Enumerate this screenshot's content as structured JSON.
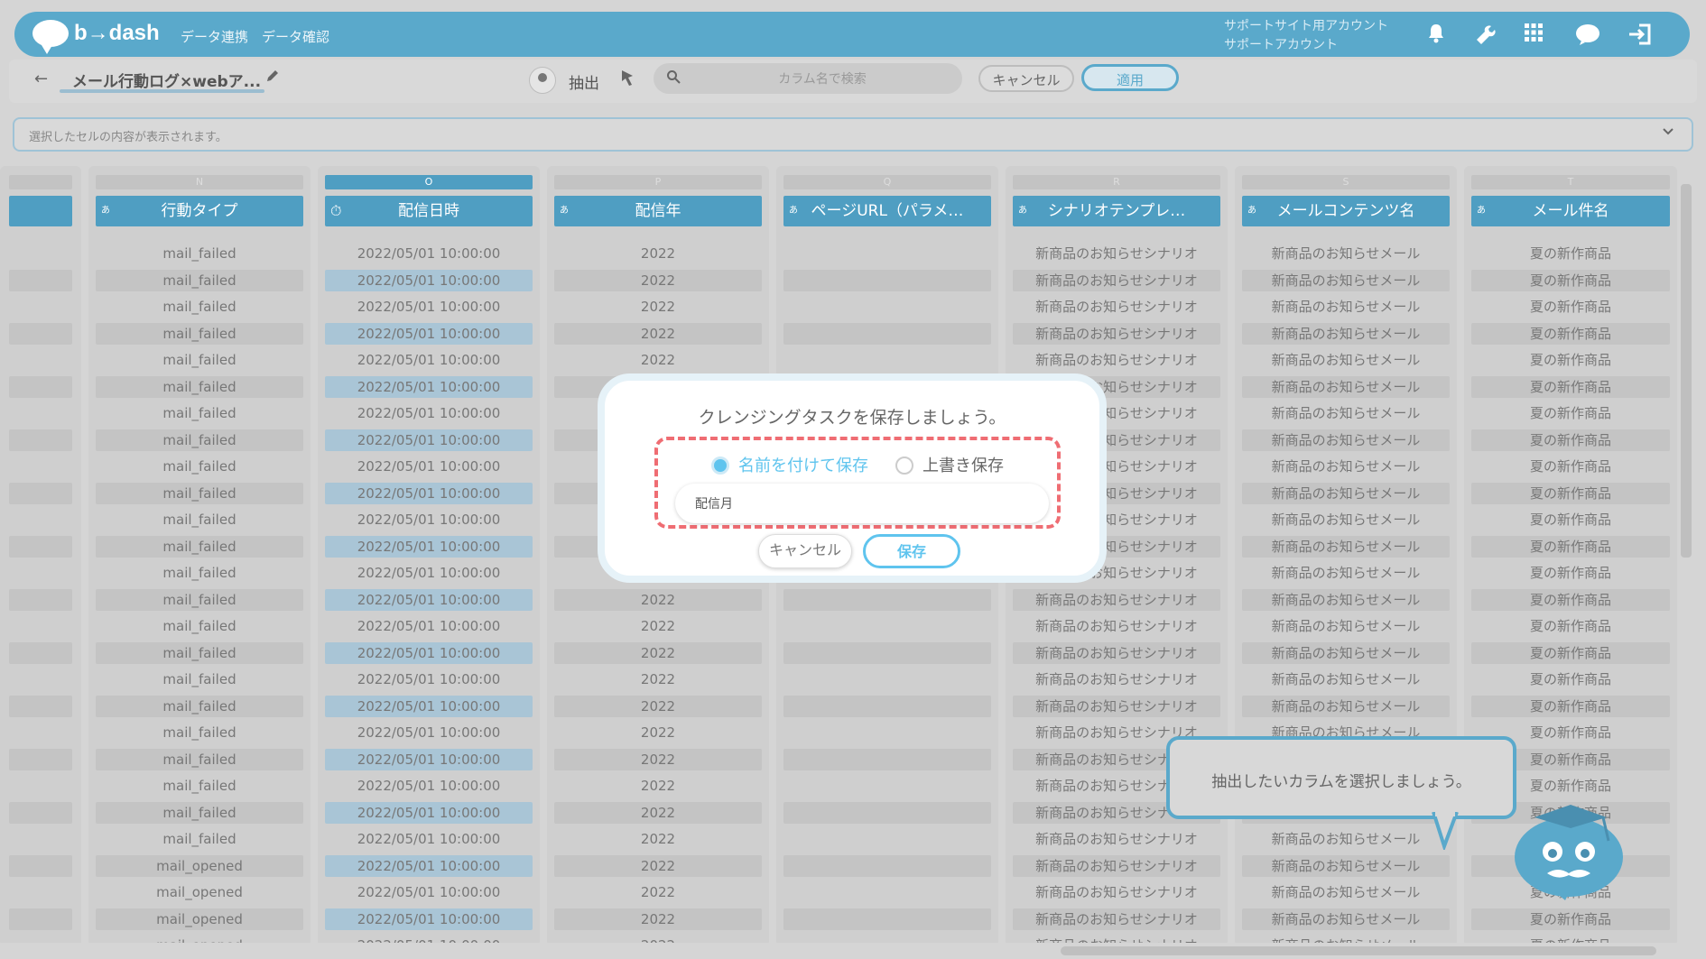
{
  "header": {
    "logo_text": "b→dash",
    "nav": [
      "データ連携",
      "データ確認"
    ],
    "account_line1": "サポートサイト用アカウント",
    "account_line2": "サポートアカウント"
  },
  "toolbar": {
    "back_glyph": "←",
    "title": "メール行動ログ×webア...",
    "extract_label": "抽出",
    "search_placeholder": "カラム名で検索",
    "cancel_label": "キャンセル",
    "apply_label": "適用"
  },
  "formula_bar": {
    "placeholder": "選択したセルの内容が表示されます。"
  },
  "columns": [
    {
      "letter": "N",
      "header": "行動タイプ",
      "type_icon": "あ",
      "selected": false
    },
    {
      "letter": "O",
      "header": "配信日時",
      "type_icon": "⏱",
      "selected": true
    },
    {
      "letter": "P",
      "header": "配信年",
      "type_icon": "あ",
      "selected": false
    },
    {
      "letter": "Q",
      "header": "ページURL（パラメ…",
      "type_icon": "あ",
      "selected": false
    },
    {
      "letter": "R",
      "header": "シナリオテンプレ…",
      "type_icon": "あ",
      "selected": false
    },
    {
      "letter": "S",
      "header": "メールコンテンツ名",
      "type_icon": "あ",
      "selected": false
    },
    {
      "letter": "T",
      "header": "メール件名",
      "type_icon": "あ",
      "selected": false
    }
  ],
  "rows": {
    "action_types": [
      "mail_failed",
      "mail_failed",
      "mail_failed",
      "mail_failed",
      "mail_failed",
      "mail_failed",
      "mail_failed",
      "mail_failed",
      "mail_failed",
      "mail_failed",
      "mail_failed",
      "mail_failed",
      "mail_failed",
      "mail_failed",
      "mail_failed",
      "mail_failed",
      "mail_failed",
      "mail_failed",
      "mail_failed",
      "mail_failed",
      "mail_failed",
      "mail_failed",
      "mail_failed",
      "mail_opened",
      "mail_opened",
      "mail_opened",
      "mail_opened"
    ],
    "datetime": "2022/05/01 10:00:00",
    "year": "2022",
    "scenario": "新商品のお知らせシナリオ",
    "content": "新商品のお知らせメール",
    "subject": "夏の新作商品"
  },
  "modal": {
    "title": "クレンジングタスクを保存しましょう。",
    "option_save_as": "名前を付けて保存",
    "option_overwrite": "上書き保存",
    "name_value": "配信月",
    "cancel_label": "キャンセル",
    "save_label": "保存"
  },
  "tooltip": {
    "text": "抽出したいカラムを選択しましょう。"
  },
  "colors": {
    "brand": "#5aa9cb",
    "accent": "#4f9ec2",
    "dash_border": "#ef6d73",
    "radio_selected": "#5fc4ee"
  }
}
